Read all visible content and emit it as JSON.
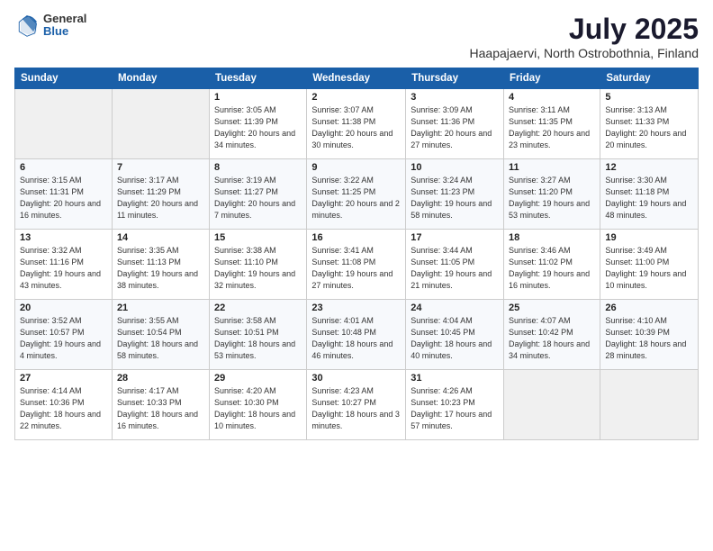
{
  "header": {
    "logo_general": "General",
    "logo_blue": "Blue",
    "month_title": "July 2025",
    "location": "Haapajaervi, North Ostrobothnia, Finland"
  },
  "days_of_week": [
    "Sunday",
    "Monday",
    "Tuesday",
    "Wednesday",
    "Thursday",
    "Friday",
    "Saturday"
  ],
  "weeks": [
    [
      {
        "day": "",
        "info": ""
      },
      {
        "day": "",
        "info": ""
      },
      {
        "day": "1",
        "info": "Sunrise: 3:05 AM\nSunset: 11:39 PM\nDaylight: 20 hours\nand 34 minutes."
      },
      {
        "day": "2",
        "info": "Sunrise: 3:07 AM\nSunset: 11:38 PM\nDaylight: 20 hours\nand 30 minutes."
      },
      {
        "day": "3",
        "info": "Sunrise: 3:09 AM\nSunset: 11:36 PM\nDaylight: 20 hours\nand 27 minutes."
      },
      {
        "day": "4",
        "info": "Sunrise: 3:11 AM\nSunset: 11:35 PM\nDaylight: 20 hours\nand 23 minutes."
      },
      {
        "day": "5",
        "info": "Sunrise: 3:13 AM\nSunset: 11:33 PM\nDaylight: 20 hours\nand 20 minutes."
      }
    ],
    [
      {
        "day": "6",
        "info": "Sunrise: 3:15 AM\nSunset: 11:31 PM\nDaylight: 20 hours\nand 16 minutes."
      },
      {
        "day": "7",
        "info": "Sunrise: 3:17 AM\nSunset: 11:29 PM\nDaylight: 20 hours\nand 11 minutes."
      },
      {
        "day": "8",
        "info": "Sunrise: 3:19 AM\nSunset: 11:27 PM\nDaylight: 20 hours\nand 7 minutes."
      },
      {
        "day": "9",
        "info": "Sunrise: 3:22 AM\nSunset: 11:25 PM\nDaylight: 20 hours\nand 2 minutes."
      },
      {
        "day": "10",
        "info": "Sunrise: 3:24 AM\nSunset: 11:23 PM\nDaylight: 19 hours\nand 58 minutes."
      },
      {
        "day": "11",
        "info": "Sunrise: 3:27 AM\nSunset: 11:20 PM\nDaylight: 19 hours\nand 53 minutes."
      },
      {
        "day": "12",
        "info": "Sunrise: 3:30 AM\nSunset: 11:18 PM\nDaylight: 19 hours\nand 48 minutes."
      }
    ],
    [
      {
        "day": "13",
        "info": "Sunrise: 3:32 AM\nSunset: 11:16 PM\nDaylight: 19 hours\nand 43 minutes."
      },
      {
        "day": "14",
        "info": "Sunrise: 3:35 AM\nSunset: 11:13 PM\nDaylight: 19 hours\nand 38 minutes."
      },
      {
        "day": "15",
        "info": "Sunrise: 3:38 AM\nSunset: 11:10 PM\nDaylight: 19 hours\nand 32 minutes."
      },
      {
        "day": "16",
        "info": "Sunrise: 3:41 AM\nSunset: 11:08 PM\nDaylight: 19 hours\nand 27 minutes."
      },
      {
        "day": "17",
        "info": "Sunrise: 3:44 AM\nSunset: 11:05 PM\nDaylight: 19 hours\nand 21 minutes."
      },
      {
        "day": "18",
        "info": "Sunrise: 3:46 AM\nSunset: 11:02 PM\nDaylight: 19 hours\nand 16 minutes."
      },
      {
        "day": "19",
        "info": "Sunrise: 3:49 AM\nSunset: 11:00 PM\nDaylight: 19 hours\nand 10 minutes."
      }
    ],
    [
      {
        "day": "20",
        "info": "Sunrise: 3:52 AM\nSunset: 10:57 PM\nDaylight: 19 hours\nand 4 minutes."
      },
      {
        "day": "21",
        "info": "Sunrise: 3:55 AM\nSunset: 10:54 PM\nDaylight: 18 hours\nand 58 minutes."
      },
      {
        "day": "22",
        "info": "Sunrise: 3:58 AM\nSunset: 10:51 PM\nDaylight: 18 hours\nand 53 minutes."
      },
      {
        "day": "23",
        "info": "Sunrise: 4:01 AM\nSunset: 10:48 PM\nDaylight: 18 hours\nand 46 minutes."
      },
      {
        "day": "24",
        "info": "Sunrise: 4:04 AM\nSunset: 10:45 PM\nDaylight: 18 hours\nand 40 minutes."
      },
      {
        "day": "25",
        "info": "Sunrise: 4:07 AM\nSunset: 10:42 PM\nDaylight: 18 hours\nand 34 minutes."
      },
      {
        "day": "26",
        "info": "Sunrise: 4:10 AM\nSunset: 10:39 PM\nDaylight: 18 hours\nand 28 minutes."
      }
    ],
    [
      {
        "day": "27",
        "info": "Sunrise: 4:14 AM\nSunset: 10:36 PM\nDaylight: 18 hours\nand 22 minutes."
      },
      {
        "day": "28",
        "info": "Sunrise: 4:17 AM\nSunset: 10:33 PM\nDaylight: 18 hours\nand 16 minutes."
      },
      {
        "day": "29",
        "info": "Sunrise: 4:20 AM\nSunset: 10:30 PM\nDaylight: 18 hours\nand 10 minutes."
      },
      {
        "day": "30",
        "info": "Sunrise: 4:23 AM\nSunset: 10:27 PM\nDaylight: 18 hours\nand 3 minutes."
      },
      {
        "day": "31",
        "info": "Sunrise: 4:26 AM\nSunset: 10:23 PM\nDaylight: 17 hours\nand 57 minutes."
      },
      {
        "day": "",
        "info": ""
      },
      {
        "day": "",
        "info": ""
      }
    ]
  ]
}
